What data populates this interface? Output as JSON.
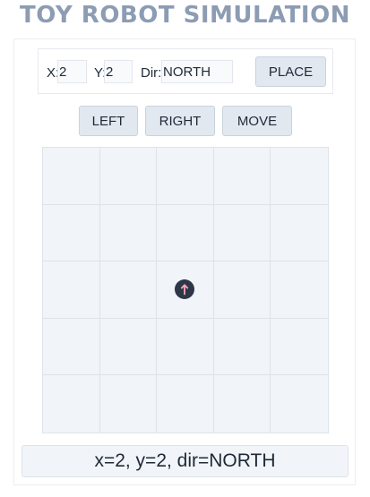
{
  "title": "TOY ROBOT SIMULATION",
  "place_form": {
    "x_label": "X:",
    "x_value": "2",
    "y_label": "Y:",
    "y_value": "2",
    "dir_label": "Dir:",
    "dir_value": "NORTH",
    "place_button": "PLACE"
  },
  "controls": {
    "left_button": "LEFT",
    "right_button": "RIGHT",
    "move_button": "MOVE"
  },
  "board": {
    "columns": 5,
    "rows": 5,
    "robot": {
      "x": 2,
      "y": 2,
      "dir": "NORTH",
      "icon": "arrow-up-icon",
      "body_color": "#2d3748",
      "arrow_color": "#f7a8b8"
    }
  },
  "status": "x=2, y=2, dir=NORTH"
}
